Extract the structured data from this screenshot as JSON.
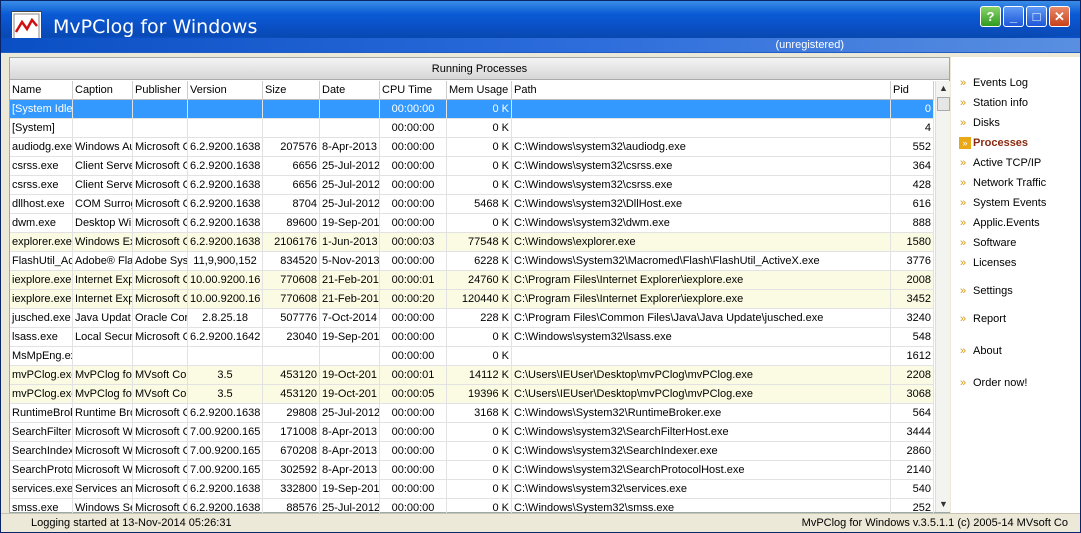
{
  "window": {
    "title": "MvPClog for Windows",
    "registration": "(unregistered)",
    "buttons": {
      "help": "?",
      "minimize": "_",
      "maximize": "□",
      "close": "✕"
    }
  },
  "table": {
    "caption": "Running Processes",
    "columns": [
      "Name",
      "Caption",
      "Publisher",
      "Version",
      "Size",
      "Date",
      "CPU Time",
      "Mem Usage",
      "Path",
      "Pid"
    ],
    "rows": [
      {
        "name": "[System Idle",
        "caption": "",
        "publisher": "",
        "version": "",
        "size": "",
        "date": "",
        "cpu": "00:00:00",
        "mem": "0 K",
        "path": "",
        "pid": "0",
        "state": "selected"
      },
      {
        "name": "[System]",
        "caption": "",
        "publisher": "",
        "version": "",
        "size": "",
        "date": "",
        "cpu": "00:00:00",
        "mem": "0 K",
        "path": "",
        "pid": "4",
        "state": ""
      },
      {
        "name": "audiodg.exe",
        "caption": "Windows Au",
        "publisher": "Microsoft C",
        "version": "6.2.9200.1638",
        "size": "207576",
        "date": "8-Apr-2013",
        "cpu": "00:00:00",
        "mem": "0 K",
        "path": "C:\\Windows\\system32\\audiodg.exe",
        "pid": "552",
        "state": ""
      },
      {
        "name": "csrss.exe",
        "caption": "Client Serve",
        "publisher": "Microsoft C",
        "version": "6.2.9200.1638",
        "size": "6656",
        "date": "25-Jul-2012",
        "cpu": "00:00:00",
        "mem": "0 K",
        "path": "C:\\Windows\\system32\\csrss.exe",
        "pid": "364",
        "state": ""
      },
      {
        "name": "csrss.exe",
        "caption": "Client Serve",
        "publisher": "Microsoft C",
        "version": "6.2.9200.1638",
        "size": "6656",
        "date": "25-Jul-2012",
        "cpu": "00:00:00",
        "mem": "0 K",
        "path": "C:\\Windows\\system32\\csrss.exe",
        "pid": "428",
        "state": ""
      },
      {
        "name": "dllhost.exe",
        "caption": "COM Surrog",
        "publisher": "Microsoft C",
        "version": "6.2.9200.1638",
        "size": "8704",
        "date": "25-Jul-2012",
        "cpu": "00:00:00",
        "mem": "5468 K",
        "path": "C:\\Windows\\system32\\DllHost.exe",
        "pid": "616",
        "state": ""
      },
      {
        "name": "dwm.exe",
        "caption": "Desktop Win",
        "publisher": "Microsoft C",
        "version": "6.2.9200.1638",
        "size": "89600",
        "date": "19-Sep-201",
        "cpu": "00:00:00",
        "mem": "0 K",
        "path": "C:\\Windows\\system32\\dwm.exe",
        "pid": "888",
        "state": ""
      },
      {
        "name": "explorer.exe",
        "caption": "Windows Ex",
        "publisher": "Microsoft C",
        "version": "6.2.9200.1638",
        "size": "2106176",
        "date": "1-Jun-2013",
        "cpu": "00:00:03",
        "mem": "77548 K",
        "path": "C:\\Windows\\explorer.exe",
        "pid": "1580",
        "state": "highlight"
      },
      {
        "name": "FlashUtil_Ac",
        "caption": "Adobe® Fla",
        "publisher": "Adobe Syst",
        "version": "11,9,900,152",
        "size": "834520",
        "date": "5-Nov-2013",
        "cpu": "00:00:00",
        "mem": "6228 K",
        "path": "C:\\Windows\\System32\\Macromed\\Flash\\FlashUtil_ActiveX.exe",
        "pid": "3776",
        "state": ""
      },
      {
        "name": "iexplore.exe",
        "caption": "Internet Exp",
        "publisher": "Microsoft C",
        "version": "10.00.9200.16",
        "size": "770608",
        "date": "21-Feb-201",
        "cpu": "00:00:01",
        "mem": "24760 K",
        "path": "C:\\Program Files\\Internet Explorer\\iexplore.exe",
        "pid": "2008",
        "state": "highlight"
      },
      {
        "name": "iexplore.exe",
        "caption": "Internet Exp",
        "publisher": "Microsoft C",
        "version": "10.00.9200.16",
        "size": "770608",
        "date": "21-Feb-201",
        "cpu": "00:00:20",
        "mem": "120440 K",
        "path": "C:\\Program Files\\Internet Explorer\\iexplore.exe",
        "pid": "3452",
        "state": "highlight"
      },
      {
        "name": "jusched.exe",
        "caption": "Java Updat",
        "publisher": "Oracle Corp",
        "version": "2.8.25.18",
        "size": "507776",
        "date": "7-Oct-2014",
        "cpu": "00:00:00",
        "mem": "228 K",
        "path": "C:\\Program Files\\Common Files\\Java\\Java Update\\jusched.exe",
        "pid": "3240",
        "state": ""
      },
      {
        "name": "lsass.exe",
        "caption": "Local Securi",
        "publisher": "Microsoft C",
        "version": "6.2.9200.1642",
        "size": "23040",
        "date": "19-Sep-201",
        "cpu": "00:00:00",
        "mem": "0 K",
        "path": "C:\\Windows\\system32\\lsass.exe",
        "pid": "548",
        "state": ""
      },
      {
        "name": "MsMpEng.ex",
        "caption": "",
        "publisher": "",
        "version": "",
        "size": "",
        "date": "",
        "cpu": "00:00:00",
        "mem": "0 K",
        "path": "",
        "pid": "1612",
        "state": ""
      },
      {
        "name": "mvPClog.exe",
        "caption": "MvPClog for",
        "publisher": "MVsoft Co",
        "version": "3.5",
        "size": "453120",
        "date": "19-Oct-201",
        "cpu": "00:00:01",
        "mem": "14112 K",
        "path": "C:\\Users\\IEUser\\Desktop\\mvPClog\\mvPClog.exe",
        "pid": "2208",
        "state": "highlight"
      },
      {
        "name": "mvPClog.exe",
        "caption": "MvPClog for",
        "publisher": "MVsoft Co",
        "version": "3.5",
        "size": "453120",
        "date": "19-Oct-201",
        "cpu": "00:00:05",
        "mem": "19396 K",
        "path": "C:\\Users\\IEUser\\Desktop\\mvPClog\\mvPClog.exe",
        "pid": "3068",
        "state": "highlight"
      },
      {
        "name": "RuntimeBrok",
        "caption": "Runtime Bro",
        "publisher": "Microsoft C",
        "version": "6.2.9200.1638",
        "size": "29808",
        "date": "25-Jul-2012",
        "cpu": "00:00:00",
        "mem": "3168 K",
        "path": "C:\\Windows\\System32\\RuntimeBroker.exe",
        "pid": "564",
        "state": ""
      },
      {
        "name": "SearchFilter",
        "caption": "Microsoft Wi",
        "publisher": "Microsoft C",
        "version": "7.00.9200.165",
        "size": "171008",
        "date": "8-Apr-2013",
        "cpu": "00:00:00",
        "mem": "0 K",
        "path": "C:\\Windows\\system32\\SearchFilterHost.exe",
        "pid": "3444",
        "state": ""
      },
      {
        "name": "SearchIndex",
        "caption": "Microsoft Wi",
        "publisher": "Microsoft C",
        "version": "7.00.9200.165",
        "size": "670208",
        "date": "8-Apr-2013",
        "cpu": "00:00:00",
        "mem": "0 K",
        "path": "C:\\Windows\\system32\\SearchIndexer.exe",
        "pid": "2860",
        "state": ""
      },
      {
        "name": "SearchProto",
        "caption": "Microsoft Wi",
        "publisher": "Microsoft C",
        "version": "7.00.9200.165",
        "size": "302592",
        "date": "8-Apr-2013",
        "cpu": "00:00:00",
        "mem": "0 K",
        "path": "C:\\Windows\\system32\\SearchProtocolHost.exe",
        "pid": "2140",
        "state": ""
      },
      {
        "name": "services.exe",
        "caption": "Services and",
        "publisher": "Microsoft C",
        "version": "6.2.9200.1638",
        "size": "332800",
        "date": "19-Sep-201",
        "cpu": "00:00:00",
        "mem": "0 K",
        "path": "C:\\Windows\\system32\\services.exe",
        "pid": "540",
        "state": ""
      },
      {
        "name": "smss.exe",
        "caption": "Windows Se",
        "publisher": "Microsoft C",
        "version": "6.2.9200.1638",
        "size": "88576",
        "date": "25-Jul-2012",
        "cpu": "00:00:00",
        "mem": "0 K",
        "path": "C:\\Windows\\System32\\smss.exe",
        "pid": "252",
        "state": ""
      }
    ]
  },
  "sidebar": {
    "items": [
      {
        "label": "Events Log",
        "active": false
      },
      {
        "label": "Station info",
        "active": false
      },
      {
        "label": "Disks",
        "active": false
      },
      {
        "label": "Processes",
        "active": true
      },
      {
        "label": "Active TCP/IP",
        "active": false
      },
      {
        "label": "Network Traffic",
        "active": false
      },
      {
        "label": "System Events",
        "active": false
      },
      {
        "label": "Applic.Events",
        "active": false
      },
      {
        "label": "Software",
        "active": false
      },
      {
        "label": "Licenses",
        "active": false
      },
      {
        "label": "Settings",
        "active": false
      },
      {
        "label": "Report",
        "active": false
      },
      {
        "label": "About",
        "active": false
      },
      {
        "label": "Order now!",
        "active": false
      }
    ]
  },
  "status": {
    "left": "Logging started at 13-Nov-2014 05:26:31",
    "right": "MvPClog for Windows v.3.5.1.1 (c) 2005-14 MVsoft Co"
  },
  "colors": {
    "selected": "#3399ff",
    "highlight": "#fbfbe3",
    "active_nav": "#8a2a10"
  }
}
